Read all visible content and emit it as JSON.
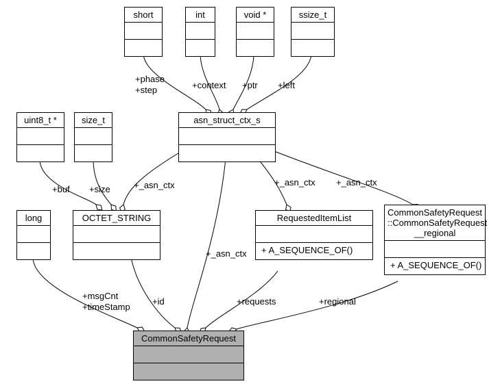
{
  "nodes": {
    "short": "short",
    "int": "int",
    "voidptr": "void *",
    "ssize_t": "ssize_t",
    "uint8ptr": "uint8_t *",
    "size_t": "size_t",
    "asn_struct": "asn_struct_ctx_s",
    "long": "long",
    "octet": "OCTET_STRING",
    "requested": "RequestedItemList",
    "requested_method": "+ A_SEQUENCE_OF()",
    "regional_line1": "CommonSafetyRequest",
    "regional_line2": "::CommonSafetyRequest",
    "regional_line3": "__regional",
    "regional_method": "+ A_SEQUENCE_OF()",
    "csr": "CommonSafetyRequest"
  },
  "edges": {
    "phase_step": "+phase\n+step",
    "context": "+context",
    "ptr": "+ptr",
    "left": "+left",
    "buf": "+buf",
    "size": "+size",
    "asnctx": "+_asn_ctx",
    "msgcnt": "+msgCnt\n+timeStamp",
    "id": "+id",
    "requests": "+requests",
    "regional": "+regional"
  },
  "chart_data": {
    "type": "table",
    "description": "UML class dependency diagram",
    "classes": [
      {
        "name": "short",
        "methods": []
      },
      {
        "name": "int",
        "methods": []
      },
      {
        "name": "void *",
        "methods": []
      },
      {
        "name": "ssize_t",
        "methods": []
      },
      {
        "name": "uint8_t *",
        "methods": []
      },
      {
        "name": "size_t",
        "methods": []
      },
      {
        "name": "asn_struct_ctx_s",
        "methods": []
      },
      {
        "name": "long",
        "methods": []
      },
      {
        "name": "OCTET_STRING",
        "methods": []
      },
      {
        "name": "RequestedItemList",
        "methods": [
          "A_SEQUENCE_OF()"
        ]
      },
      {
        "name": "CommonSafetyRequest::CommonSafetyRequest__regional",
        "methods": [
          "A_SEQUENCE_OF()"
        ]
      },
      {
        "name": "CommonSafetyRequest",
        "methods": []
      }
    ],
    "relations": [
      {
        "from": "asn_struct_ctx_s",
        "to": "short",
        "label": "+phase +step"
      },
      {
        "from": "asn_struct_ctx_s",
        "to": "int",
        "label": "+context"
      },
      {
        "from": "asn_struct_ctx_s",
        "to": "void *",
        "label": "+ptr"
      },
      {
        "from": "asn_struct_ctx_s",
        "to": "ssize_t",
        "label": "+left"
      },
      {
        "from": "OCTET_STRING",
        "to": "uint8_t *",
        "label": "+buf"
      },
      {
        "from": "OCTET_STRING",
        "to": "size_t",
        "label": "+size"
      },
      {
        "from": "OCTET_STRING",
        "to": "asn_struct_ctx_s",
        "label": "+_asn_ctx"
      },
      {
        "from": "RequestedItemList",
        "to": "asn_struct_ctx_s",
        "label": "+_asn_ctx"
      },
      {
        "from": "CommonSafetyRequest::CommonSafetyRequest__regional",
        "to": "asn_struct_ctx_s",
        "label": "+_asn_ctx"
      },
      {
        "from": "CommonSafetyRequest",
        "to": "long",
        "label": "+msgCnt +timeStamp"
      },
      {
        "from": "CommonSafetyRequest",
        "to": "OCTET_STRING",
        "label": "+id"
      },
      {
        "from": "CommonSafetyRequest",
        "to": "asn_struct_ctx_s",
        "label": "+_asn_ctx"
      },
      {
        "from": "CommonSafetyRequest",
        "to": "RequestedItemList",
        "label": "+requests"
      },
      {
        "from": "CommonSafetyRequest",
        "to": "CommonSafetyRequest::CommonSafetyRequest__regional",
        "label": "+regional"
      }
    ]
  }
}
